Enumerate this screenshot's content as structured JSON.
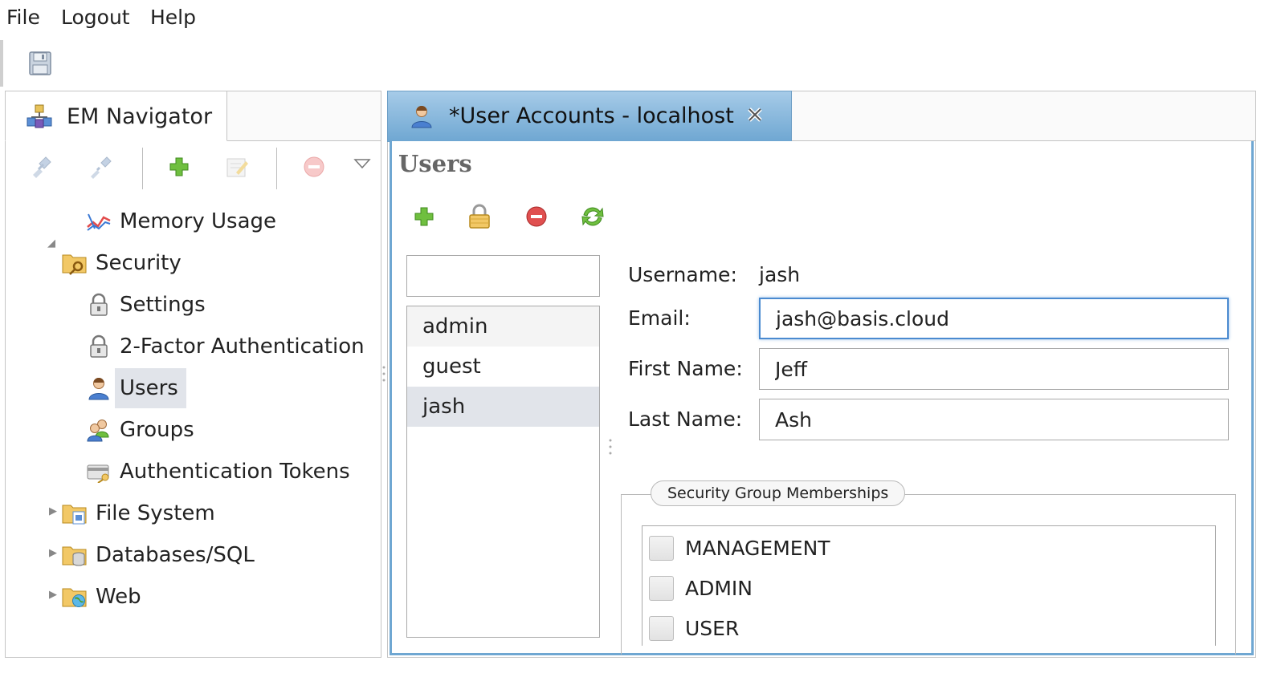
{
  "menu": {
    "file": "File",
    "logout": "Logout",
    "help": "Help"
  },
  "toolbar": {
    "save_icon": "save-icon"
  },
  "navigator": {
    "tab_label": "EM Navigator",
    "tab_icon": "navigator-icon",
    "tools": [
      "connect-icon",
      "disconnect-icon",
      "add-icon",
      "edit-icon",
      "remove-icon",
      "dropdown-icon"
    ],
    "tree": [
      {
        "label": "Memory Usage",
        "icon": "chart-icon"
      },
      {
        "label": "Security",
        "icon": "folder-key-icon",
        "expanded": true
      },
      {
        "label": "Settings",
        "icon": "lock-icon"
      },
      {
        "label": "2-Factor Authentication",
        "icon": "lock-icon"
      },
      {
        "label": "Users",
        "icon": "user-icon",
        "selected": true
      },
      {
        "label": "Groups",
        "icon": "group-icon"
      },
      {
        "label": "Authentication Tokens",
        "icon": "token-icon"
      },
      {
        "label": "File System",
        "icon": "folder-file-icon",
        "expanded": false
      },
      {
        "label": "Databases/SQL",
        "icon": "folder-db-icon",
        "expanded": false
      },
      {
        "label": "Web",
        "icon": "folder-web-icon",
        "expanded": false
      }
    ]
  },
  "editor": {
    "tab_label": "*User Accounts - localhost",
    "tab_icon": "user-icon",
    "close_icon": "close-icon",
    "section_title": "Users",
    "tools": [
      "add-user-icon",
      "lock-icon",
      "remove-icon",
      "refresh-icon"
    ],
    "filter": {
      "value": "",
      "placeholder": ""
    },
    "users": [
      "admin",
      "guest",
      "jash"
    ],
    "selected_user": "jash",
    "form": {
      "username_label": "Username:",
      "username_value": "jash",
      "email_label": "Email:",
      "email_value": "jash@basis.cloud",
      "first_name_label": "First Name:",
      "first_name_value": "Jeff",
      "last_name_label": "Last Name:",
      "last_name_value": "Ash"
    },
    "groups_legend": "Security Group Memberships",
    "groups": [
      {
        "name": "MANAGEMENT",
        "checked": false
      },
      {
        "name": "ADMIN",
        "checked": false
      },
      {
        "name": "USER",
        "checked": false
      }
    ]
  },
  "colors": {
    "tab_active": "#6fa7d2",
    "selection": "#e1e4ea",
    "focus_border": "#4a8ad0"
  }
}
